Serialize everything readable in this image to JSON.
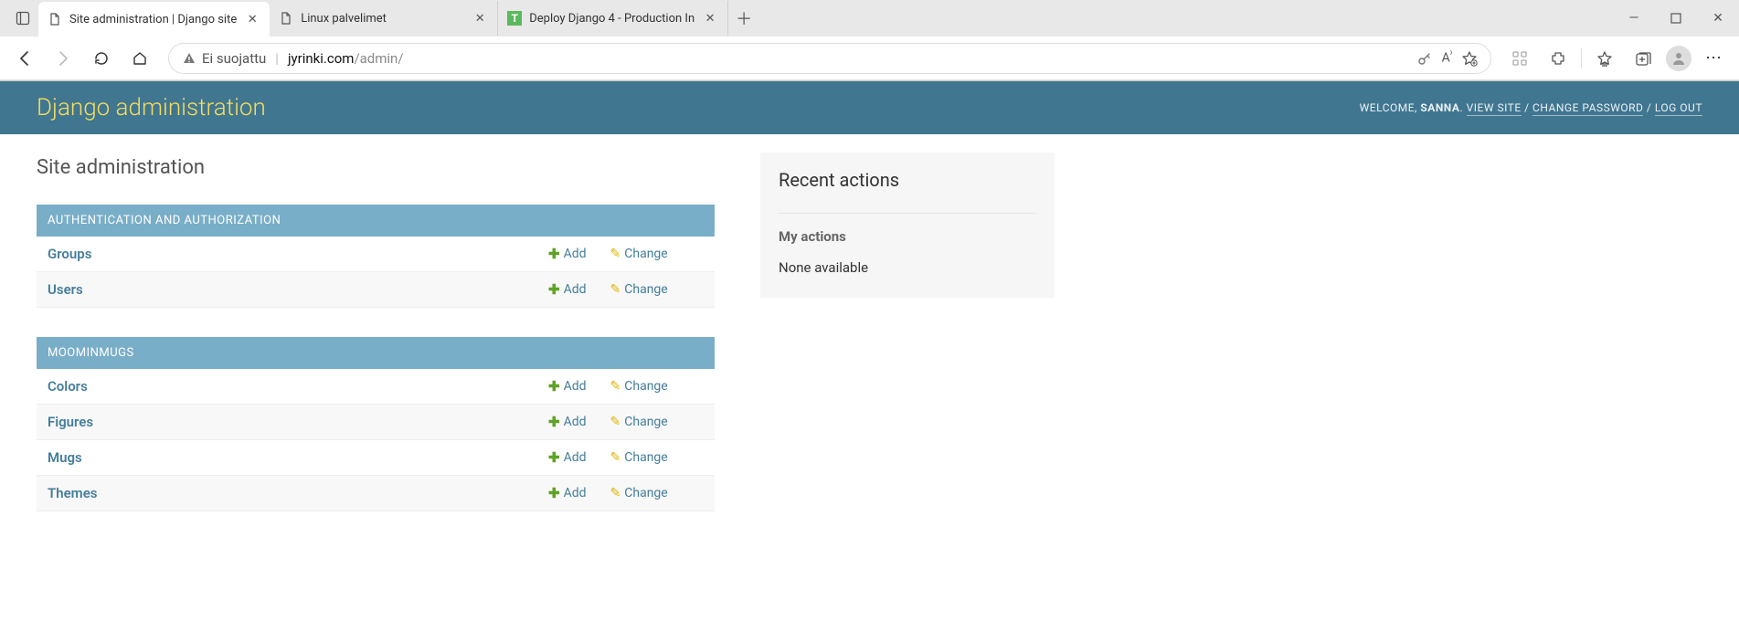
{
  "browser": {
    "tabs": [
      {
        "title": "Site administration | Django site",
        "icon": "page-icon",
        "active": true
      },
      {
        "title": "Linux palvelimet",
        "icon": "page-icon",
        "active": false
      },
      {
        "title": "Deploy Django 4 - Production In",
        "icon": "t-icon",
        "active": false
      }
    ],
    "omnibox": {
      "not_secure_label": "Ei suojattu",
      "host": "jyrinki.com",
      "path": "/admin/"
    }
  },
  "header": {
    "branding": "Django administration",
    "welcome_prefix": "WELCOME, ",
    "user": "SANNA",
    "view_site": "VIEW SITE",
    "change_password": "CHANGE PASSWORD",
    "log_out": "LOG OUT"
  },
  "page_title": "Site administration",
  "modules": [
    {
      "caption": "AUTHENTICATION AND AUTHORIZATION",
      "rows": [
        {
          "name": "Groups",
          "add": "Add",
          "change": "Change"
        },
        {
          "name": "Users",
          "add": "Add",
          "change": "Change"
        }
      ]
    },
    {
      "caption": "MOOMINMUGS",
      "rows": [
        {
          "name": "Colors",
          "add": "Add",
          "change": "Change"
        },
        {
          "name": "Figures",
          "add": "Add",
          "change": "Change"
        },
        {
          "name": "Mugs",
          "add": "Add",
          "change": "Change"
        },
        {
          "name": "Themes",
          "add": "Add",
          "change": "Change"
        }
      ]
    }
  ],
  "recent_actions": {
    "title": "Recent actions",
    "subtitle": "My actions",
    "none": "None available"
  }
}
